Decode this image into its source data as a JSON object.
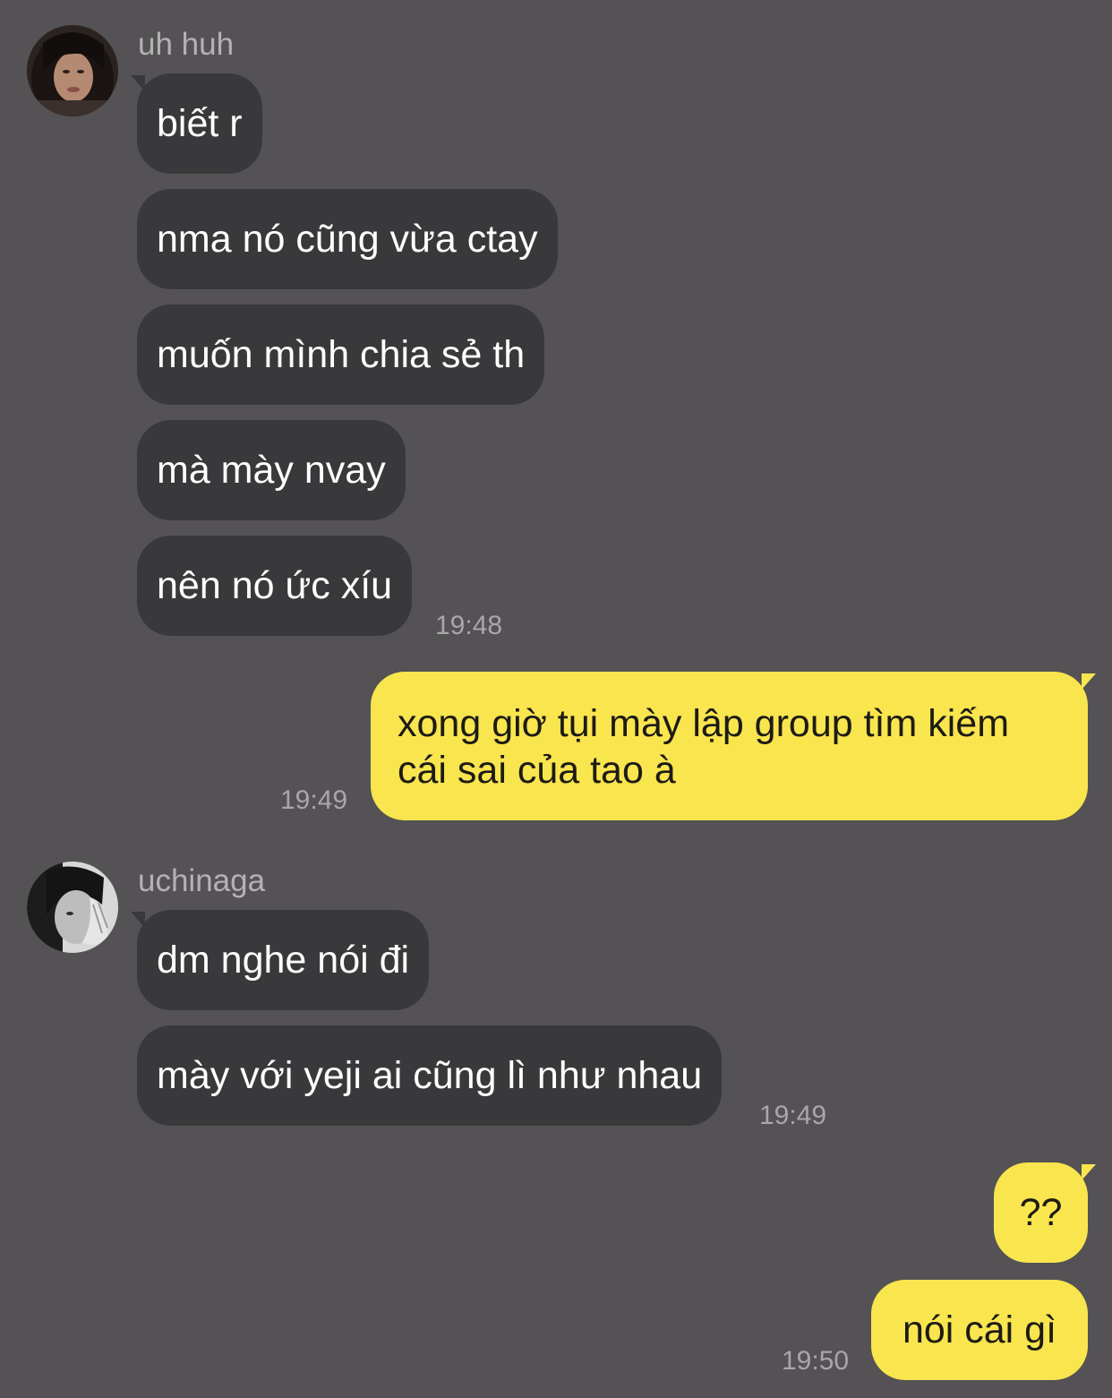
{
  "conversation": {
    "group1": {
      "sender": "uh huh",
      "avatar_icon": "user-photo-icon",
      "messages": [
        {
          "text": "biết r"
        },
        {
          "text": "nma nó cũng vừa ctay"
        },
        {
          "text": "muốn mình chia sẻ th"
        },
        {
          "text": "mà mày nvay"
        },
        {
          "text": "nên nó ức xíu"
        }
      ],
      "time": "19:48"
    },
    "outgoing1": {
      "lines": [
        "xong giờ tụi mày lập group tìm kiếm",
        "cái sai của tao à"
      ],
      "time": "19:49"
    },
    "group2": {
      "sender": "uchinaga",
      "avatar_icon": "user-photo-icon",
      "messages": [
        {
          "text": "dm nghe nói đi"
        },
        {
          "text": "mày với yeji ai cũng lì như nhau"
        }
      ],
      "time": "19:49"
    },
    "outgoing2": {
      "messages": [
        {
          "text": "??"
        },
        {
          "text": "nói cái gì"
        }
      ],
      "time": "19:50"
    }
  },
  "colors": {
    "background": "#545254",
    "incoming_bubble": "#39383b",
    "outgoing_bubble": "#f9e54e",
    "timestamp": "#a9a6a9",
    "sender_name": "#b4b1b4"
  }
}
